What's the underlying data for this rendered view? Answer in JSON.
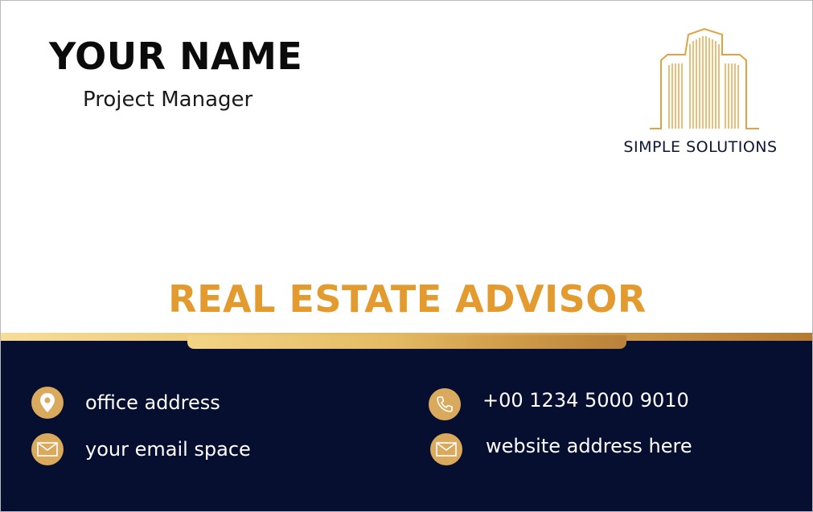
{
  "card": {
    "name": "YOUR NAME",
    "role": "Project Manager",
    "company": "SIMPLE SOLUTIONS",
    "headline": "REAL ESTATE ADVISOR",
    "logo_icon": "building-logo-icon"
  },
  "contacts": {
    "address": {
      "text": "office address",
      "icon": "location-pin-icon"
    },
    "email": {
      "text": "your email space",
      "icon": "envelope-icon"
    },
    "phone": {
      "text": "+00 1234 5000 9010",
      "icon": "phone-icon"
    },
    "website": {
      "text": "website address here",
      "icon": "envelope-icon"
    }
  },
  "colors": {
    "navy": "#070f30",
    "gold": "#e39a2f",
    "icon_gold": "#d9aa5d",
    "logo_gold": "#e0a33f"
  }
}
